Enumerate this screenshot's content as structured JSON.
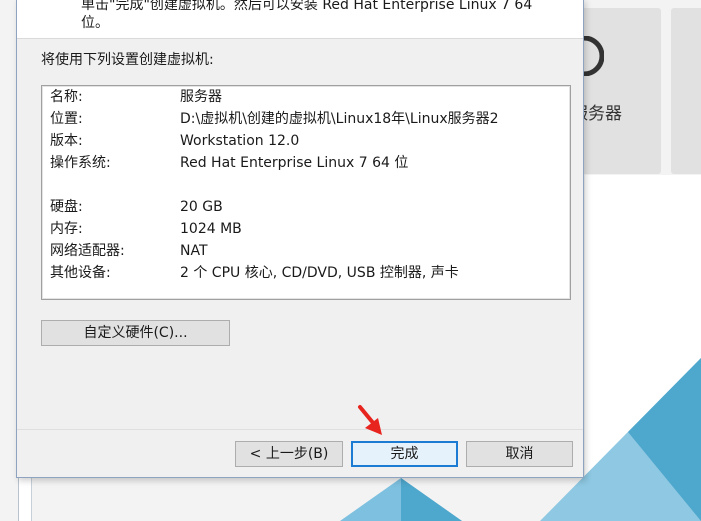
{
  "background": {
    "card_label": "服务器"
  },
  "dialog": {
    "header_text": "单击\"完成\"创建虚拟机。然后可以安装 Red Hat Enterprise Linux 7 64\n位。",
    "section_label": "将使用下列设置创建虚拟机:",
    "summary": [
      {
        "key": "名称:",
        "value": "服务器"
      },
      {
        "key": "位置:",
        "value": "D:\\虚拟机\\创建的虚拟机\\Linux18年\\Linux服务器2"
      },
      {
        "key": "版本:",
        "value": "Workstation 12.0"
      },
      {
        "key": "操作系统:",
        "value": "Red Hat Enterprise Linux 7 64 位"
      },
      {
        "key": "硬盘:",
        "value": "20 GB"
      },
      {
        "key": "内存:",
        "value": "1024 MB"
      },
      {
        "key": "网络适配器:",
        "value": "NAT"
      },
      {
        "key": "其他设备:",
        "value": "2 个 CPU 核心, CD/DVD, USB 控制器, 声卡"
      }
    ],
    "buttons": {
      "customize_hardware": "自定义硬件(C)...",
      "back": "< 上一步(B)",
      "finish": "完成",
      "cancel": "取消"
    }
  },
  "colors": {
    "accent": "#1c7bd3",
    "arrow": "#e8241f",
    "triangle_light": "#8ec8e2",
    "triangle_dark": "#4ea7cc"
  },
  "icons": {
    "pointer": "red-arrow-icon"
  }
}
